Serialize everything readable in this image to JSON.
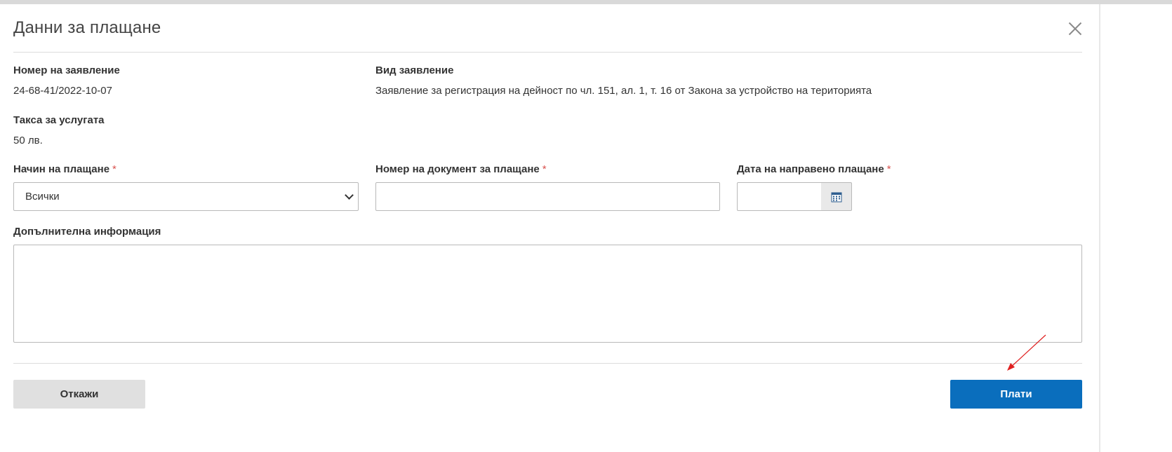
{
  "modal": {
    "title": "Данни за плащане",
    "application_number_label": "Номер на заявление",
    "application_number_value": "24-68-41/2022-10-07",
    "application_type_label": "Вид заявление",
    "application_type_value": "Заявление за регистрация на дейност по чл. 151, ал. 1, т. 16 от Закона за устройство на територията",
    "fee_label": "Такса за услугата",
    "fee_value": "50 лв."
  },
  "form": {
    "payment_method_label": "Начин на плащане",
    "payment_method_selected": "Всички",
    "payment_doc_label": "Номер на документ за плащане",
    "payment_doc_value": "",
    "payment_date_label": "Дата на направено плащане",
    "payment_date_value": "",
    "required_mark": "*",
    "additional_info_label": "Допълнителна информация",
    "additional_info_value": ""
  },
  "actions": {
    "cancel_label": "Откажи",
    "pay_label": "Плати"
  },
  "colors": {
    "primary": "#0a6ebd",
    "required": "#d9534f",
    "annotation_arrow": "#e02020"
  },
  "icons": {
    "close": "close-icon",
    "select_arrow": "chevron-down-icon",
    "calendar": "calendar-icon"
  }
}
